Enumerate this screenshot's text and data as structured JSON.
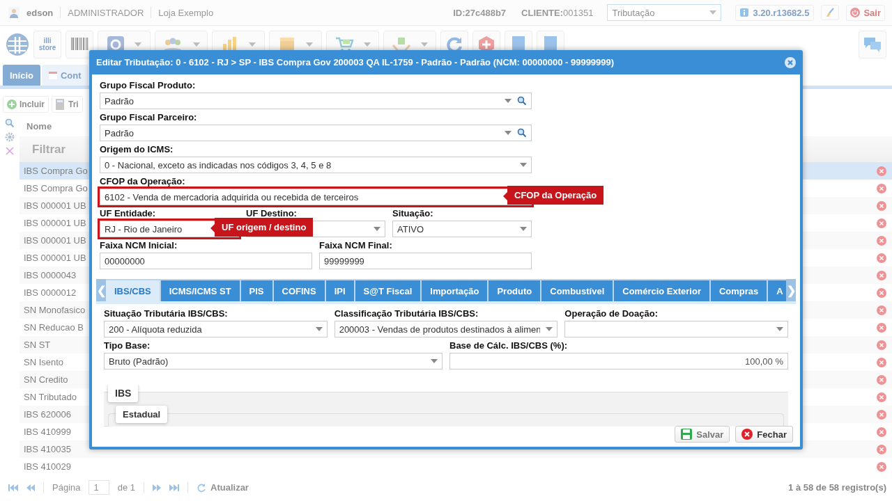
{
  "header": {
    "user": "edson",
    "role": "ADMINISTRADOR",
    "store": "Loja Exemplo",
    "id": "ID:27c488b7",
    "client": "**CLIENTE:**001351",
    "module": "Tributação",
    "version": "3.20.r13682.5",
    "logout": "Sair"
  },
  "toolbar": {
    "store_logo": "illi store"
  },
  "page_tabs": [
    {
      "label": "Início",
      "selected": true
    },
    {
      "label": "Cont",
      "selected": false
    }
  ],
  "actions": [
    {
      "label": "Incluir",
      "kind": "add"
    },
    {
      "label": "Tri",
      "kind": "calc"
    }
  ],
  "grid": {
    "column": "Nome",
    "filter_placeholder": "Filtrar",
    "rows": [
      {
        "name": "IBS Compra Go",
        "selected": true
      },
      {
        "name": "IBS Compra Go",
        "selected": false
      },
      {
        "name": "IBS 000001 UB",
        "selected": false
      },
      {
        "name": "IBS 000001 UB",
        "selected": false
      },
      {
        "name": "IBS 000001 UB",
        "selected": false
      },
      {
        "name": "IBS 000001 UB",
        "selected": false
      },
      {
        "name": "IBS 0000043",
        "selected": false
      },
      {
        "name": "IBS 0000012",
        "selected": false
      },
      {
        "name": "SN Monofasico",
        "selected": false
      },
      {
        "name": "SN Reducao B",
        "selected": false
      },
      {
        "name": "SN ST",
        "selected": false
      },
      {
        "name": "SN Isento",
        "selected": false
      },
      {
        "name": "SN Credito",
        "selected": false
      },
      {
        "name": "SN Tributado",
        "selected": false
      },
      {
        "name": "IBS 620006",
        "selected": false
      },
      {
        "name": "IBS 410999",
        "selected": false
      },
      {
        "name": "IBS 410035",
        "selected": false
      },
      {
        "name": "IBS 410029",
        "selected": false
      }
    ]
  },
  "pager": {
    "page_label": "Página",
    "page": "1",
    "of": "de 1",
    "refresh": "Atualizar",
    "summary": "1 à 58 de 58 registro(s)"
  },
  "dialog": {
    "title": "Editar Tributação: 0 - 6102 - RJ > SP - IBS Compra Gov 200003 QA IL-1759 - Padrão - Padrão (NCM: 00000000 - 99999999)",
    "rows": [
      [
        {
          "label": "Grupo Fiscal Produto:",
          "kind": "lookup",
          "value": "Padrão"
        }
      ],
      [
        {
          "label": "Grupo Fiscal Parceiro:",
          "kind": "lookup",
          "value": "Padrão"
        }
      ],
      [
        {
          "label": "Origem do ICMS:",
          "kind": "select",
          "value": "0 - Nacional, exceto as indicadas nos códigos 3, 4, 5 e 8"
        }
      ],
      [
        {
          "label": "CFOP da Operação:",
          "kind": "text",
          "value": "6102 - Venda de mercadoria adquirida ou recebida de terceiros",
          "callout": "CFOP da Operação"
        }
      ],
      [
        {
          "label": "UF Entidade:",
          "kind": "text",
          "value": "RJ - Rio de Janeiro",
          "callout": "UF origem / destino"
        },
        {
          "label": "UF Destino:",
          "kind": "select"
        },
        {
          "label": "Situação:",
          "kind": "select",
          "value": "ATIVO"
        }
      ],
      [
        {
          "label": "Faixa NCM Inicial:",
          "kind": "text",
          "value": "00000000"
        },
        {
          "label": "Faixa NCM Final:",
          "kind": "text",
          "value": "99999999"
        }
      ]
    ],
    "tab_prev": "❮",
    "tab_next": "❯",
    "tabs": [
      {
        "label": "IBS/CBS",
        "selected": true
      },
      {
        "label": "ICMS/ICMS ST",
        "selected": false
      },
      {
        "label": "PIS",
        "selected": false
      },
      {
        "label": "COFINS",
        "selected": false
      },
      {
        "label": "IPI",
        "selected": false
      },
      {
        "label": "S@T Fiscal",
        "selected": false
      },
      {
        "label": "Importação",
        "selected": false
      },
      {
        "label": "Produto",
        "selected": false
      },
      {
        "label": "Combustível",
        "selected": false
      },
      {
        "label": "Comércio Exterior",
        "selected": false
      },
      {
        "label": "Compras",
        "selected": false
      },
      {
        "label": "A",
        "selected": false
      }
    ],
    "tab_rows": [
      [
        {
          "label": "Situação Tributária IBS/CBS:",
          "kind": "select",
          "value": "200 - Alíquota reduzida"
        },
        {
          "label": "Classificação Tributária IBS/CBS:",
          "kind": "select",
          "value": "200003 - Vendas de produtos destinados à alimen"
        },
        {
          "label": "Operação de Doação:",
          "kind": "select"
        }
      ],
      [
        {
          "label": "Tipo Base:",
          "kind": "select",
          "value": "Bruto (Padrão)"
        },
        {
          "label": "Base de Cálc. IBS/CBS (%):",
          "kind": "number",
          "value": "100,00 %"
        }
      ]
    ],
    "groups": [
      {
        "legend": "IBS",
        "children": [
          {
            "legend": "Estadual"
          }
        ]
      }
    ],
    "buttons": [
      {
        "label": "Salvar",
        "kind": "save",
        "disabled": true
      },
      {
        "label": "Fechar",
        "kind": "close",
        "disabled": false
      }
    ]
  }
}
